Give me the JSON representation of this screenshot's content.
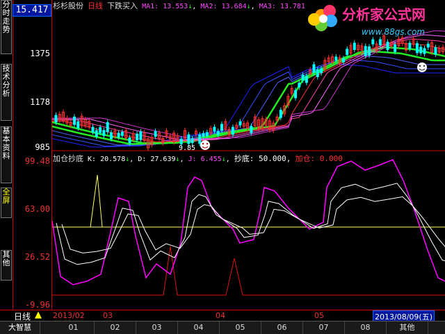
{
  "price_top": "15.417",
  "side_tabs": [
    "分时走势",
    "技术分析",
    "基本资料",
    "全屏",
    "其他"
  ],
  "stock": {
    "name": "杉杉股份",
    "period": "日线",
    "indicator": "下跌买入"
  },
  "ma": {
    "ma1_label": "MA1: 13.553",
    "ma1_arrow": "↓",
    "ma2_label": "MA2: 13.684",
    "ma2_arrow": "↓",
    "ma3_label": "MA3: 13.781"
  },
  "price_axis": [
    "1375",
    "1178",
    "985"
  ],
  "low_marker": "9.85",
  "osc": {
    "name": "加仓抄底",
    "k_label": "K: 20.578",
    "k_arrow": "↓",
    "d_label": "D: 27.639",
    "d_arrow": "↓",
    "j_label": "J: 6.455",
    "j_arrow": "↓",
    "chaodi_label": "抄底: 50.000,",
    "jiacang_label": "加仓: 0.000"
  },
  "osc_axis": [
    "99.48",
    "63.00",
    "26.52",
    "-9.96"
  ],
  "bottom": {
    "period_label": "日线",
    "month_labels": [
      "2013/02",
      "03",
      "04",
      "05"
    ],
    "current_date": "2013/08/09(五)"
  },
  "date_tabs": [
    "大智慧",
    "01",
    "02",
    "03",
    "04",
    "05",
    "06",
    "07",
    "08",
    "其他"
  ],
  "logo": {
    "text": "分析家公式网",
    "url": "www.88gs.com"
  },
  "colors": {
    "up": "#ff3030",
    "down": "#00ffff",
    "ma_green": "#22ee22",
    "k": "#ffffff",
    "d": "#ffffff",
    "j": "#ff00ff",
    "axis": "#cc0000",
    "label": "#ffff00"
  }
}
